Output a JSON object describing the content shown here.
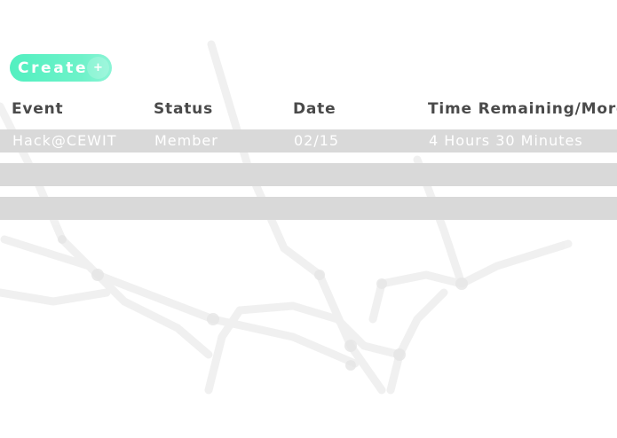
{
  "toolbar": {
    "create_label": "Create",
    "create_icon": "+"
  },
  "table": {
    "columns": [
      "Event",
      "Status",
      "Date",
      "Time Remaining/More"
    ],
    "rows": [
      {
        "event": "Hack@CEWIT",
        "status": "Member",
        "date": "02/15",
        "time_remaining": "4 Hours 30 Minutes"
      },
      {
        "event": "",
        "status": "",
        "date": "",
        "time_remaining": ""
      },
      {
        "event": "",
        "status": "",
        "date": "",
        "time_remaining": ""
      }
    ]
  },
  "colors": {
    "accent": "#52f0c0",
    "row_background": "#d9d9d9",
    "header_text": "#4a4a4a"
  }
}
